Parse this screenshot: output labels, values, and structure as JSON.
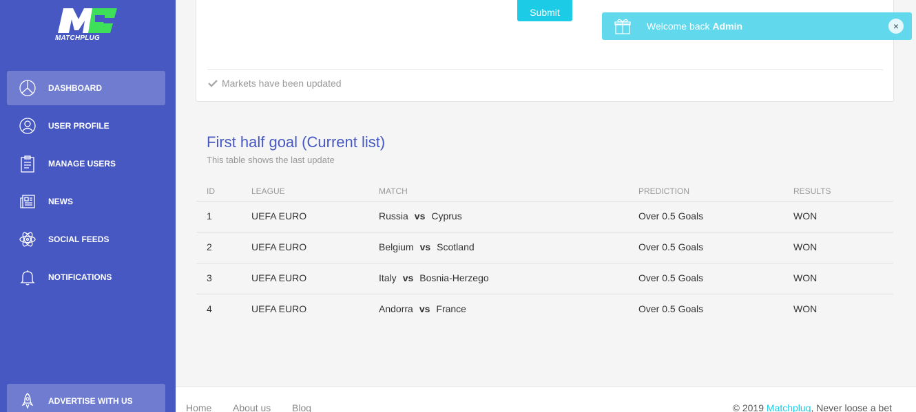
{
  "brand": {
    "name": "MATCHPLUG",
    "logo_letters": "M"
  },
  "sidebar": {
    "items": [
      {
        "label": "DASHBOARD",
        "icon": "pie-chart-icon",
        "active": true
      },
      {
        "label": "USER PROFILE",
        "icon": "user-icon"
      },
      {
        "label": "MANAGE USERS",
        "icon": "clipboard-icon"
      },
      {
        "label": "NEWS",
        "icon": "newspaper-icon"
      },
      {
        "label": "SOCIAL FEEDS",
        "icon": "atom-icon"
      },
      {
        "label": "NOTIFICATIONS",
        "icon": "bell-icon"
      }
    ],
    "advertise": {
      "label": "ADVERTISE WITH US",
      "icon": "rocket-icon"
    }
  },
  "form": {
    "submit_label": "Submit",
    "status": "Markets have been updated"
  },
  "toast": {
    "prefix": "Welcome back ",
    "user": "Admin",
    "close": "×",
    "icon": "gift-icon"
  },
  "table": {
    "title": "First half goal (Current list)",
    "subtitle": "This table shows the last update",
    "columns": [
      "ID",
      "LEAGUE",
      "MATCH",
      "PREDICTION",
      "RESULTS"
    ],
    "vs_label": "vs",
    "rows": [
      {
        "id": "1",
        "league": "UEFA EURO",
        "home": "Russia",
        "away": "Cyprus",
        "prediction": "Over 0.5 Goals",
        "result": "WON"
      },
      {
        "id": "2",
        "league": "UEFA EURO",
        "home": "Belgium",
        "away": "Scotland",
        "prediction": "Over 0.5 Goals",
        "result": "WON"
      },
      {
        "id": "3",
        "league": "UEFA EURO",
        "home": "Italy",
        "away": "Bosnia-Herzego",
        "prediction": "Over 0.5 Goals",
        "result": "WON"
      },
      {
        "id": "4",
        "league": "UEFA EURO",
        "home": "Andorra",
        "away": "France",
        "prediction": "Over 0.5 Goals",
        "result": "WON"
      }
    ]
  },
  "footer": {
    "links": [
      "Home",
      "About us",
      "Blog"
    ],
    "copyright_prefix": "© 2019 ",
    "copyright_brand": "Matchplug",
    "copyright_suffix": ", Never loose a bet"
  },
  "colors": {
    "sidebar": "#4758c3",
    "accent": "#1ccbe6",
    "toast": "#62d8ed",
    "logo_green": "#3ee05a"
  }
}
